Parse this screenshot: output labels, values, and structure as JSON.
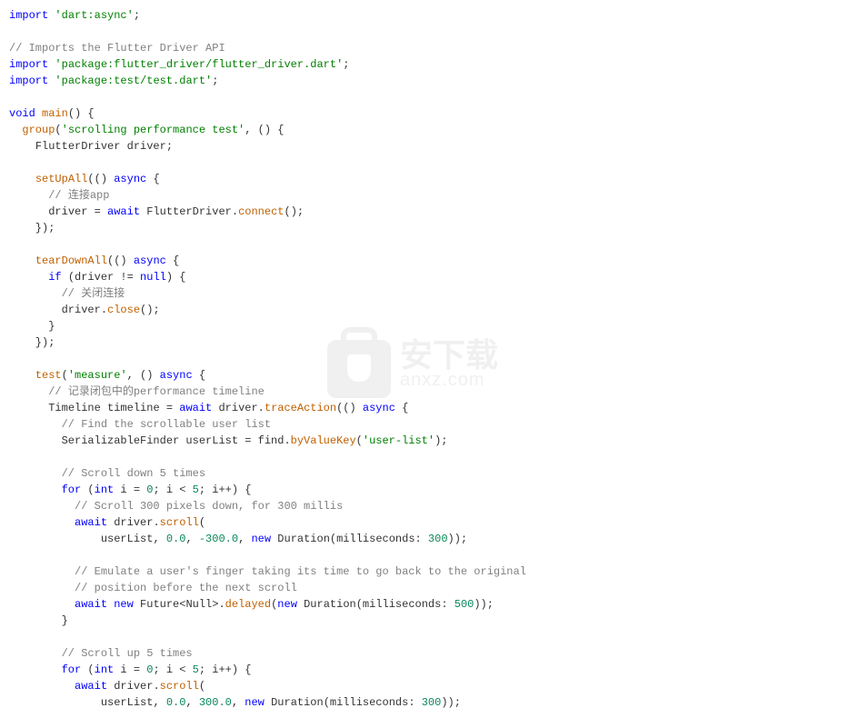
{
  "colors": {
    "keyword": "#0000ff",
    "string": "#008000",
    "comment": "#808080",
    "function": "#c06000",
    "number": "#098658",
    "text": "#333333"
  },
  "watermark": {
    "cn": "安下载",
    "en": "anxz.com"
  },
  "code": {
    "l1_kw": "import",
    "l1_str": "'dart:async'",
    "l3_com": "// Imports the Flutter Driver API",
    "l4_kw": "import",
    "l4_str": "'package:flutter_driver/flutter_driver.dart'",
    "l5_kw": "import",
    "l5_str": "'package:test/test.dart'",
    "l7_kw": "void",
    "l7_fn": "main",
    "l8_fn": "group",
    "l8_str": "'scrolling performance test'",
    "l9_txt": "FlutterDriver driver;",
    "l11_fn": "setUpAll",
    "l11_kw": "async",
    "l12_com": "// 连接app",
    "l13_txt_a": "driver = ",
    "l13_kw": "await",
    "l13_txt_b": " FlutterDriver.",
    "l13_fn": "connect",
    "l16_fn": "tearDownAll",
    "l16_kw": "async",
    "l17_kw": "if",
    "l17_txt": " (driver != ",
    "l17_null": "null",
    "l18_com": "// 关闭连接",
    "l19_txt": "driver.",
    "l19_fn": "close",
    "l23_fn": "test",
    "l23_str": "'measure'",
    "l23_kw": "async",
    "l24_com": "// 记录闭包中的performance timeline",
    "l25_txt_a": "Timeline timeline = ",
    "l25_kw": "await",
    "l25_txt_b": " driver.",
    "l25_fn": "traceAction",
    "l25_kw2": "async",
    "l26_com": "// Find the scrollable user list",
    "l27_txt_a": "SerializableFinder userList = find.",
    "l27_fn": "byValueKey",
    "l27_str": "'user-list'",
    "l29_com": "// Scroll down 5 times",
    "l30_kw": "for",
    "l30_txt_a": " (",
    "l30_kw2": "int",
    "l30_txt_b": " i = ",
    "l30_n0": "0",
    "l30_txt_c": "; i < ",
    "l30_n5": "5",
    "l30_txt_d": "; i++) {",
    "l31_com": "// Scroll 300 pixels down, for 300 millis",
    "l32_kw": "await",
    "l32_txt": " driver.",
    "l32_fn": "scroll",
    "l33_txt_a": "userList, ",
    "l33_n1": "0.0",
    "l33_txt_b": ", ",
    "l33_n2": "-300.0",
    "l33_txt_c": ", ",
    "l33_kw": "new",
    "l33_txt_d": " Duration(milliseconds: ",
    "l33_n3": "300",
    "l35_com": "// Emulate a user's finger taking its time to go back to the original",
    "l36_com": "// position before the next scroll",
    "l37_kw": "await",
    "l37_kw2": "new",
    "l37_txt_a": " Future<Null>.",
    "l37_fn": "delayed",
    "l37_kw3": "new",
    "l37_txt_b": " Duration(milliseconds: ",
    "l37_n": "500",
    "l40_com": "// Scroll up 5 times",
    "l41_kw": "for",
    "l41_kw2": "int",
    "l41_n0": "0",
    "l41_n5": "5",
    "l42_kw": "await",
    "l42_txt": " driver.",
    "l42_fn": "scroll",
    "l43_txt_a": "userList, ",
    "l43_n1": "0.0",
    "l43_n2": "300.0",
    "l43_kw": "new",
    "l43_txt_b": " Duration(milliseconds: ",
    "l43_n3": "300"
  }
}
